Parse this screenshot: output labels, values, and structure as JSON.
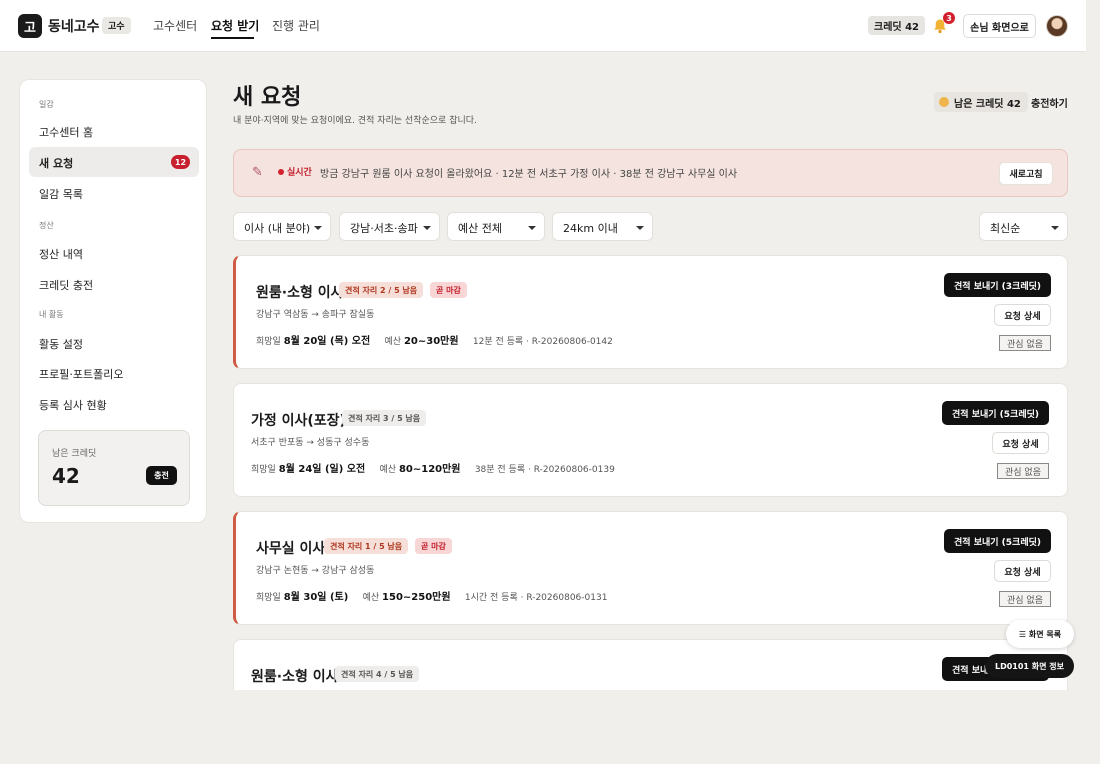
{
  "header": {
    "logo_char": "고",
    "brand": "동네고수",
    "role_badge": "고수",
    "nav": [
      {
        "label": "고수센터"
      },
      {
        "label": "요청 받기"
      },
      {
        "label": "진행 관리"
      }
    ],
    "credit_pill": "크레딧 42",
    "notification_count": "3",
    "customer_view_button": "손님 화면으로"
  },
  "sidebar": {
    "sections": [
      {
        "title": "일감",
        "items": [
          {
            "label": "고수센터 홈"
          },
          {
            "label": "새 요청",
            "badge": "12"
          },
          {
            "label": "일감 목록"
          }
        ]
      },
      {
        "title": "정산",
        "items": [
          {
            "label": "정산 내역"
          },
          {
            "label": "크레딧 충전"
          }
        ]
      },
      {
        "title": "내 활동",
        "items": [
          {
            "label": "활동 설정"
          },
          {
            "label": "프로필·포트폴리오"
          },
          {
            "label": "등록 심사 현황"
          }
        ]
      }
    ],
    "credit_card": {
      "label": "남은 크레딧",
      "value": "42",
      "button": "충전"
    }
  },
  "main": {
    "title": "새 요청",
    "subtitle": "내 분야·지역에 맞는 요청이에요. 견적 자리는 선착순으로 찹니다.",
    "remaining_credits": "남은 크레딧 42",
    "recharge_link": "충전하기",
    "banner": {
      "live_label": "실시간",
      "text": "방금 강남구 원룸 이사 요청이 올라왔어요 · 12분 전 서초구 가정 이사 · 38분 전 강남구 사무실 이사",
      "refresh_button": "새로고침"
    },
    "filters": [
      {
        "label": "이사 (내 분야)"
      },
      {
        "label": "강남·서초·송파"
      },
      {
        "label": "예산 전체"
      },
      {
        "label": "24km 이내"
      }
    ],
    "sort": "최신순",
    "requests": [
      {
        "title": "원룸·소형 이사",
        "slots": "견적 자리 2 / 5 남음",
        "deadline": "곧 마감",
        "route": "강남구 역삼동 → 송파구 잠실동",
        "date_label": "희망일",
        "date": "8월 20일 (목) 오전",
        "budget_label": "예산",
        "budget": "20~30만원",
        "registered": "12분 전 등록 · R-20260806-0142",
        "send_button": "견적 보내기 (3크레딧)",
        "detail_button": "요청 상세",
        "not_interested": "관심 없음"
      },
      {
        "title": "가정 이사(포장)",
        "slots": "견적 자리 3 / 5 남음",
        "route": "서초구 반포동 → 성동구 성수동",
        "date_label": "희망일",
        "date": "8월 24일 (일) 오전",
        "budget_label": "예산",
        "budget": "80~120만원",
        "registered": "38분 전 등록 · R-20260806-0139",
        "send_button": "견적 보내기 (5크레딧)",
        "detail_button": "요청 상세",
        "not_interested": "관심 없음"
      },
      {
        "title": "사무실 이사",
        "slots": "견적 자리 1 / 5 남음",
        "deadline": "곧 마감",
        "route": "강남구 논현동 → 강남구 삼성동",
        "date_label": "희망일",
        "date": "8월 30일 (토)",
        "budget_label": "예산",
        "budget": "150~250만원",
        "registered": "1시간 전 등록 · R-20260806-0131",
        "send_button": "견적 보내기 (5크레딧)",
        "detail_button": "요청 상세",
        "not_interested": "관심 없음"
      },
      {
        "title": "원룸·소형 이사",
        "slots": "견적 자리 4 / 5 남음",
        "send_button": "견적 보내기"
      }
    ]
  },
  "floating": {
    "screen_list": "☰ 화면 목록",
    "screen_info": "LD0101 화면 정보"
  },
  "colors": {
    "accent_urgent": "#cf5b46",
    "badge_red": "#c8202e",
    "primary_button": "#111111",
    "banner_bg": "#f4e3de"
  }
}
